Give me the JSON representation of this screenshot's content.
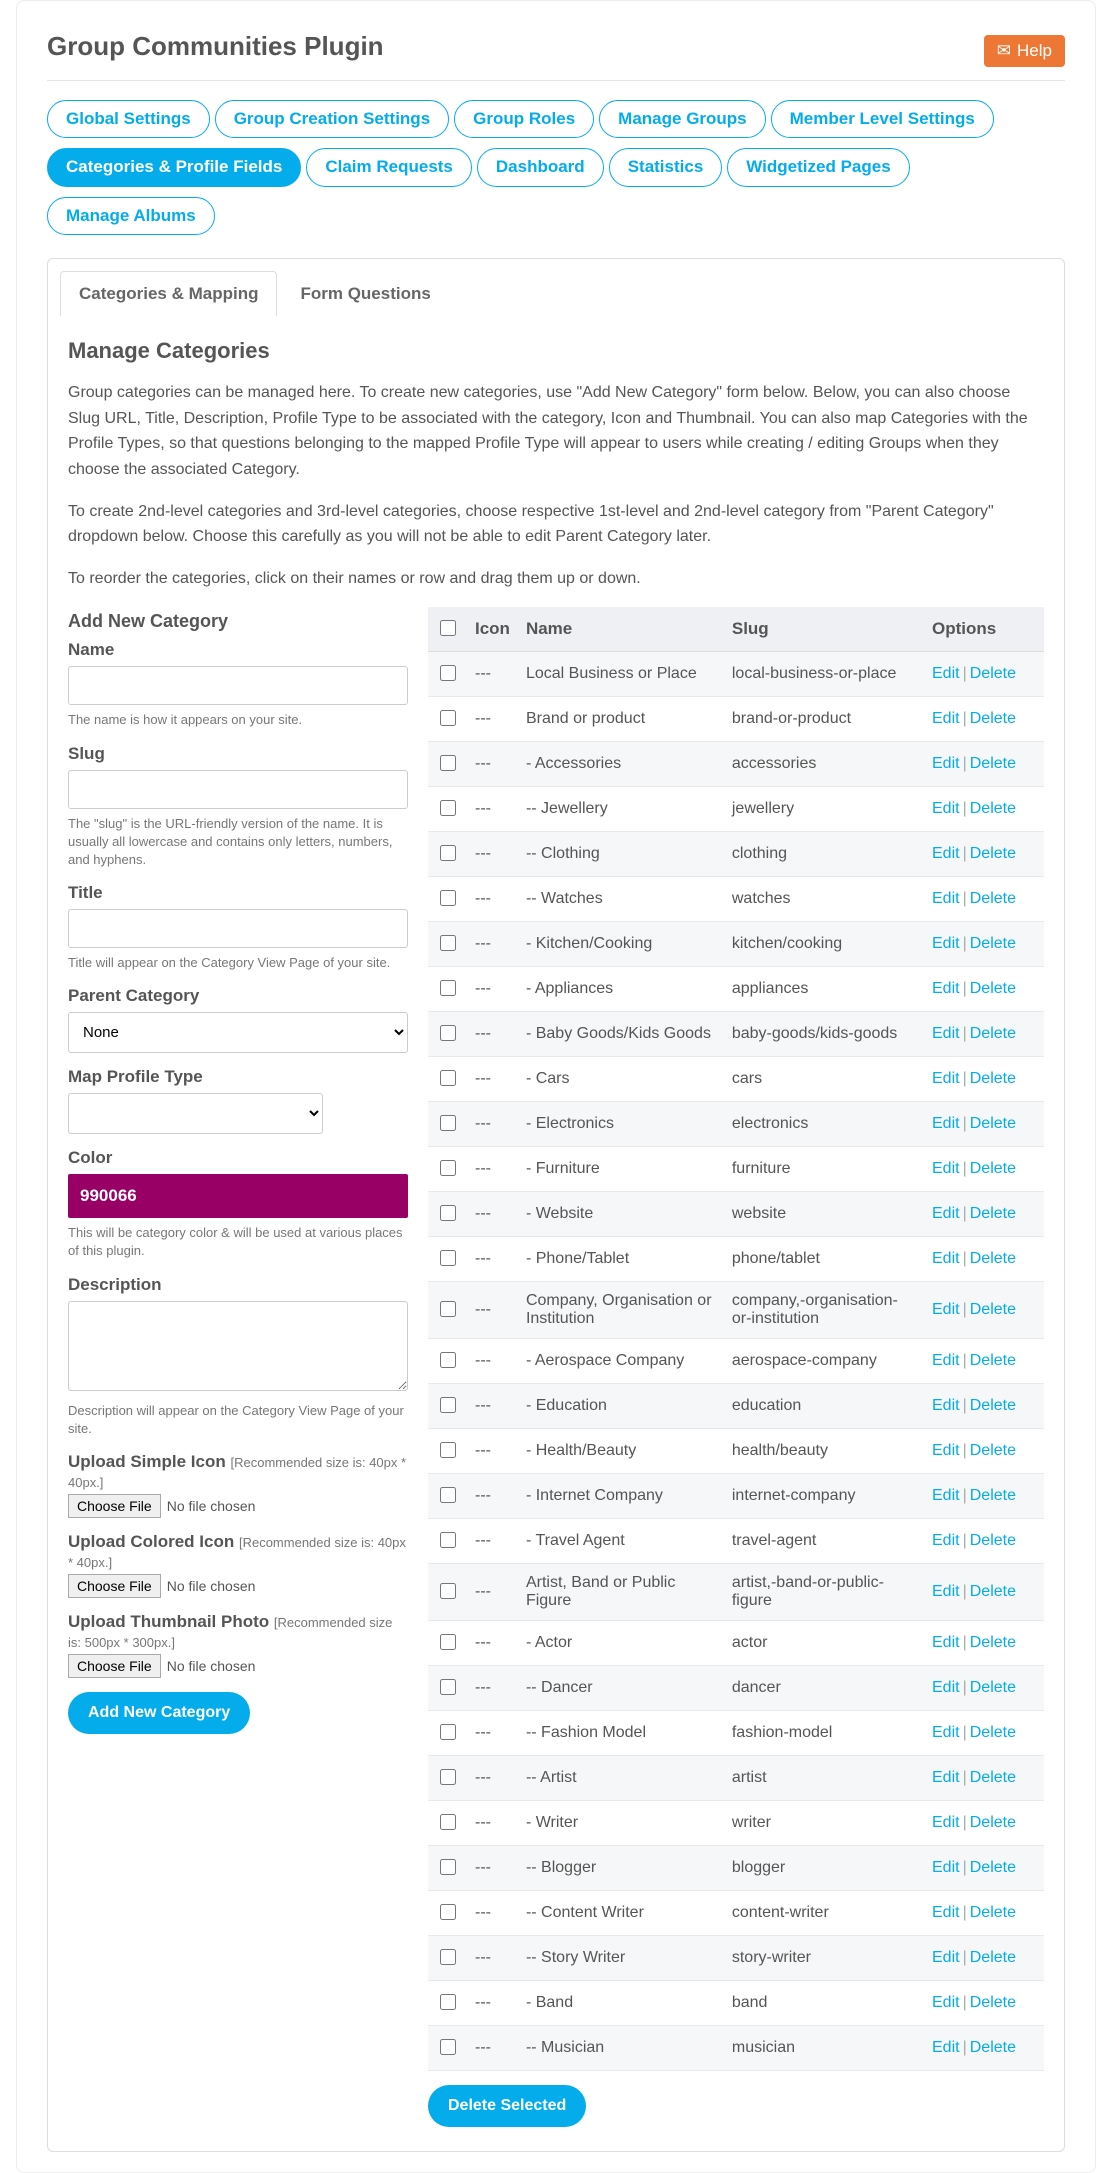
{
  "page_title": "Group Communities Plugin",
  "help_label": "Help",
  "nav_pills": [
    {
      "label": "Global Settings",
      "active": false
    },
    {
      "label": "Group Creation Settings",
      "active": false
    },
    {
      "label": "Group Roles",
      "active": false
    },
    {
      "label": "Manage Groups",
      "active": false
    },
    {
      "label": "Member Level Settings",
      "active": false
    },
    {
      "label": "Categories & Profile Fields",
      "active": true
    },
    {
      "label": "Claim Requests",
      "active": false
    },
    {
      "label": "Dashboard",
      "active": false
    },
    {
      "label": "Statistics",
      "active": false
    },
    {
      "label": "Widgetized Pages",
      "active": false
    },
    {
      "label": "Manage Albums",
      "active": false
    }
  ],
  "sub_tabs": [
    {
      "label": "Categories & Mapping",
      "active": true
    },
    {
      "label": "Form Questions",
      "active": false
    }
  ],
  "section_title": "Manage Categories",
  "desc_p1": "Group categories can be managed here. To create new categories, use \"Add New Category\" form below. Below, you can also choose Slug URL, Title, Description, Profile Type to be associated with the category, Icon and Thumbnail. You can also map Categories with the Profile Types, so that questions belonging to the mapped Profile Type will appear to users while creating / editing Groups when they choose the associated Category.",
  "desc_p2": "To create 2nd-level categories and 3rd-level categories, choose respective 1st-level and 2nd-level category from \"Parent Category\" dropdown below. Choose this carefully as you will not be able to edit Parent Category later.",
  "desc_p3": "To reorder the categories, click on their names or row and drag them up or down.",
  "form": {
    "title": "Add New Category",
    "name_label": "Name",
    "name_help": "The name is how it appears on your site.",
    "slug_label": "Slug",
    "slug_help": "The \"slug\" is the URL-friendly version of the name. It is usually all lowercase and contains only letters, numbers, and hyphens.",
    "title_label": "Title",
    "title_help": "Title will appear on the Category View Page of your site.",
    "parent_label": "Parent Category",
    "parent_value": "None",
    "map_label": "Map Profile Type",
    "map_value": "",
    "color_label": "Color",
    "color_value": "990066",
    "color_help": "This will be category color & will be used at various places of this plugin.",
    "desc_label": "Description",
    "desc_help": "Description will appear on the Category View Page of your site.",
    "upload_simple_label": "Upload Simple Icon",
    "upload_simple_rec": "[Recommended size is: 40px * 40px.]",
    "upload_colored_label": "Upload Colored Icon",
    "upload_colored_rec": "[Recommended size is: 40px * 40px.]",
    "upload_thumb_label": "Upload Thumbnail Photo",
    "upload_thumb_rec": "[Recommended size is: 500px * 300px.]",
    "choose_file_btn": "Choose File",
    "no_file_txt": "No file chosen",
    "submit_label": "Add New Category"
  },
  "table": {
    "headers": {
      "icon": "Icon",
      "name": "Name",
      "slug": "Slug",
      "options": "Options"
    },
    "edit_label": "Edit",
    "delete_label": "Delete",
    "delete_selected": "Delete Selected",
    "icon_placeholder": "---",
    "rows": [
      {
        "name": "Local Business or Place",
        "slug": "local-business-or-place"
      },
      {
        "name": "Brand or product",
        "slug": "brand-or-product"
      },
      {
        "name": "- Accessories",
        "slug": "accessories"
      },
      {
        "name": "-- Jewellery",
        "slug": "jewellery"
      },
      {
        "name": "-- Clothing",
        "slug": "clothing"
      },
      {
        "name": "-- Watches",
        "slug": "watches"
      },
      {
        "name": "- Kitchen/Cooking",
        "slug": "kitchen/cooking"
      },
      {
        "name": "- Appliances",
        "slug": "appliances"
      },
      {
        "name": "- Baby Goods/Kids Goods",
        "slug": "baby-goods/kids-goods"
      },
      {
        "name": "- Cars",
        "slug": "cars"
      },
      {
        "name": "- Electronics",
        "slug": "electronics"
      },
      {
        "name": "- Furniture",
        "slug": "furniture"
      },
      {
        "name": "- Website",
        "slug": "website"
      },
      {
        "name": "- Phone/Tablet",
        "slug": "phone/tablet"
      },
      {
        "name": "Company, Organisation or Institution",
        "slug": "company,-organisation-or-institution"
      },
      {
        "name": "- Aerospace Company",
        "slug": "aerospace-company"
      },
      {
        "name": "- Education",
        "slug": "education"
      },
      {
        "name": "- Health/Beauty",
        "slug": "health/beauty"
      },
      {
        "name": "- Internet Company",
        "slug": "internet-company"
      },
      {
        "name": "- Travel Agent",
        "slug": "travel-agent"
      },
      {
        "name": "Artist, Band or Public Figure",
        "slug": "artist,-band-or-public-figure"
      },
      {
        "name": "- Actor",
        "slug": "actor"
      },
      {
        "name": "-- Dancer",
        "slug": "dancer"
      },
      {
        "name": "-- Fashion Model",
        "slug": "fashion-model"
      },
      {
        "name": "-- Artist",
        "slug": "artist"
      },
      {
        "name": "- Writer",
        "slug": "writer"
      },
      {
        "name": "-- Blogger",
        "slug": "blogger"
      },
      {
        "name": "-- Content Writer",
        "slug": "content-writer"
      },
      {
        "name": "-- Story Writer",
        "slug": "story-writer"
      },
      {
        "name": "- Band",
        "slug": "band"
      },
      {
        "name": "-- Musician",
        "slug": "musician"
      }
    ]
  }
}
